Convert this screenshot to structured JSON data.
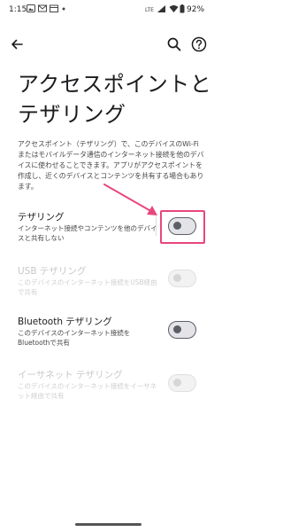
{
  "status_bar": {
    "time": "1:15",
    "battery": "92%"
  },
  "page": {
    "title_line1": "アクセスポイントと",
    "title_line2": "テザリング",
    "description": "アクセスポイント（テザリング）で、このデバイスのWi-Fi またはモバイルデータ通信のインターネット接続を他のデバイスに使わせることできます。アプリがアクセスポイントを作成し、近くのデバイスとコンテンツを共有する場合もあります。"
  },
  "settings": [
    {
      "title": "テザリング",
      "subtitle": "インターネット接続やコンテンツを他のデバイスと共有しない",
      "enabled": true,
      "checked": false
    },
    {
      "title": "USB テザリング",
      "subtitle": "このデバイスのインターネット接続をUSB経由で共有",
      "enabled": false,
      "checked": false
    },
    {
      "title": "Bluetooth テザリング",
      "subtitle": "このデバイスのインターネット接続をBluetoothで共有",
      "enabled": true,
      "checked": false
    },
    {
      "title": "イーサネット テザリング",
      "subtitle": "このデバイスのインターネット接続をイーサネット経由で共有",
      "enabled": false,
      "checked": false
    }
  ],
  "colors": {
    "highlight": "#e8467c",
    "toggle_off": "#5c5f67"
  },
  "icons": [
    "back-arrow-icon",
    "search-icon",
    "help-icon"
  ]
}
